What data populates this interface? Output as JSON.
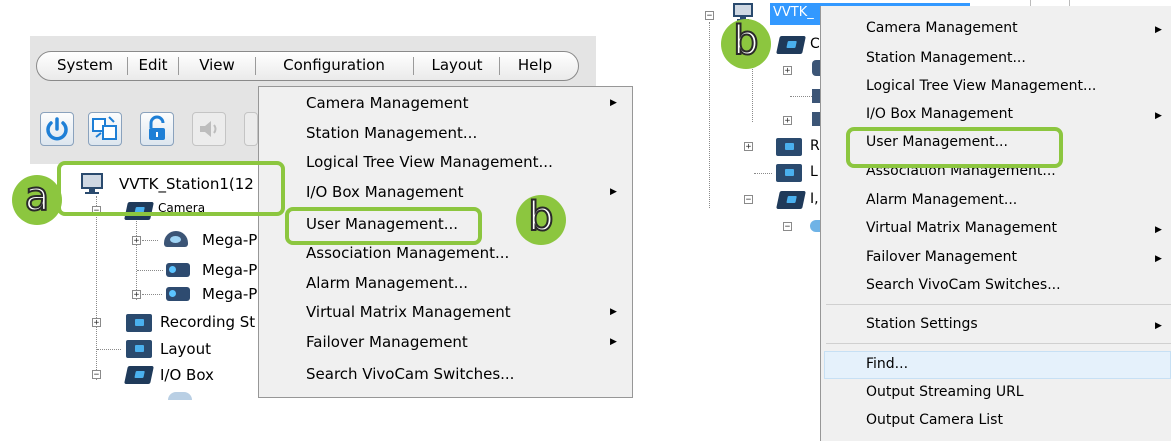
{
  "left_panel": {
    "menubar": [
      "System",
      "Edit",
      "View",
      "Configuration",
      "Layout",
      "Help"
    ],
    "tree": {
      "station": "VVTK_Station1(12",
      "camera_folder": "Camera",
      "cameras": [
        "Mega-P",
        "Mega-P",
        "Mega-P"
      ],
      "recording": "Recording St",
      "layout": "Layout",
      "io_box": "I/O Box"
    },
    "context_menu": [
      {
        "label": "Camera Management",
        "submenu": true
      },
      {
        "label": "Station Management...",
        "submenu": false
      },
      {
        "label": "Logical Tree View Management...",
        "submenu": false
      },
      {
        "label": "I/O Box Management",
        "submenu": true
      },
      {
        "label": "User Management...",
        "submenu": false
      },
      {
        "label": "Association Management...",
        "submenu": false
      },
      {
        "label": "Alarm Management...",
        "submenu": false
      },
      {
        "label": "Virtual Matrix Management",
        "submenu": true
      },
      {
        "label": "Failover Management",
        "submenu": true
      },
      {
        "label": "Search VivoCam Switches...",
        "submenu": false
      }
    ],
    "badge_a": "a",
    "badge_b": "b"
  },
  "right_panel": {
    "station_partial": "VVTK_",
    "tree_partial": [
      "C",
      "R",
      "L",
      "I,"
    ],
    "context_menu": [
      {
        "label": "Camera Management",
        "submenu": true
      },
      {
        "label": "Station Management...",
        "submenu": false
      },
      {
        "label": "Logical Tree View Management...",
        "submenu": false
      },
      {
        "label": "I/O Box Management",
        "submenu": true
      },
      {
        "label": "User Management...",
        "submenu": false
      },
      {
        "label": "Association Management...",
        "submenu": false
      },
      {
        "label": "Alarm Management...",
        "submenu": false
      },
      {
        "label": "Virtual Matrix Management",
        "submenu": true
      },
      {
        "label": "Failover Management",
        "submenu": true
      },
      {
        "label": "Search VivoCam Switches...",
        "submenu": false
      },
      {
        "label": "Station Settings",
        "submenu": true
      },
      {
        "label": "Find...",
        "submenu": false
      },
      {
        "label": "Output Streaming URL",
        "submenu": false
      },
      {
        "label": "Output Camera List",
        "submenu": false
      }
    ],
    "badge_b": "b"
  },
  "colors": {
    "highlight_green": "#8cc63f",
    "selection_blue": "#3399ff",
    "menu_bg": "#f0f0f0",
    "folder_dark": "#2a4a6e"
  },
  "icons": {
    "toolbar": [
      "power-icon",
      "network-icon",
      "lock-icon",
      "speaker-icon"
    ]
  }
}
